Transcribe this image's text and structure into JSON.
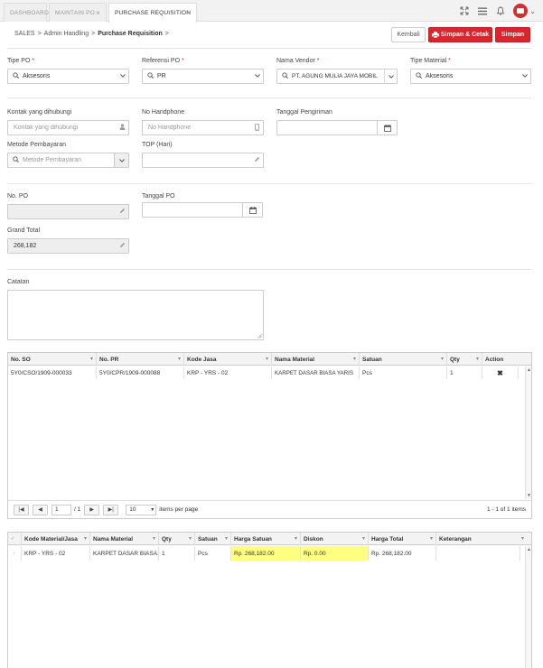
{
  "tabs": [
    {
      "label": "DASHBOARD",
      "closable": false
    },
    {
      "label": "MAINTAIN PO",
      "closable": true
    },
    {
      "label": "PURCHASE REQUISITION",
      "closable": true
    }
  ],
  "tab_close_glyph": "×",
  "topbar": {
    "icons": [
      "expand-icon",
      "menu-icon",
      "bell-icon",
      "user-avatar",
      "chevron-down-icon"
    ],
    "chevron": "⌄"
  },
  "breadcrumb": [
    {
      "label": "SALES",
      "sep": ">"
    },
    {
      "label": "Admin Handling",
      "sep": ">"
    },
    {
      "label": "Purchase Requisition",
      "sep": ">"
    }
  ],
  "actions": {
    "back": "Kembali",
    "save_print": "Simpan & Cetak",
    "save": "Simpan"
  },
  "form": {
    "tipe_po": {
      "label": "Tipe PO",
      "required": "*",
      "value": "Aksesoris"
    },
    "referensi_po": {
      "label": "Referensi PO",
      "required": "*",
      "value": "PR"
    },
    "nama_vendor": {
      "label": "Nama Vendor",
      "required": "*",
      "value": "PT. AGUNG MULIA JAYA MOBIL"
    },
    "tipe_material": {
      "label": "Tipe Material",
      "required": "*",
      "value": "Aksesoris"
    },
    "kontak": {
      "label": "Kontak yang dihubungi",
      "placeholder": "Kontak yang dihubungi"
    },
    "no_handphone": {
      "label": "No Handphone",
      "placeholder": "No Handphone"
    },
    "tanggal_pengiriman": {
      "label": "Tanggal Pengiriman",
      "value": ""
    },
    "metode_pembayaran": {
      "label": "Metode Pembayaran",
      "placeholder": "Metode Pembayaran"
    },
    "top": {
      "label": "TOP (Hari)",
      "value": ""
    },
    "no_po": {
      "label": "No. PO",
      "value": ""
    },
    "tanggal_po": {
      "label": "Tanggal PO",
      "value": ""
    },
    "grand_total": {
      "label": "Grand Total",
      "value": "268,182"
    },
    "catatan": {
      "label": "Catatan",
      "value": ""
    }
  },
  "grid1": {
    "columns": [
      "No. SO",
      "No. PR",
      "Kode Jasa",
      "Nama Material",
      "Satuan",
      "Qty",
      "Action"
    ],
    "rows": [
      [
        "5Y0/CSO/1909-000033",
        "5Y0/CPR/1909-000088",
        "KRP - YRS - 02",
        "KARPET DASAR BIASA YARIS",
        "Pcs",
        "1",
        "✖"
      ]
    ],
    "pager": {
      "first": "|◀",
      "prev": "◀",
      "page": "1",
      "of": "/ 1",
      "next": "▶",
      "last": "▶|",
      "page_size": "10",
      "page_size_caret": "▾",
      "items_per_page": "items per page",
      "summary": "1 - 1 of 1 items"
    }
  },
  "grid2": {
    "columns": [
      "",
      "Kode Material/Jasa",
      "Nama Material",
      "Qty",
      "Satuan",
      "Harga Satuan",
      "Diskon",
      "Harga Total",
      "Keterangan"
    ],
    "rows": [
      [
        "",
        "KRP - YRS - 02",
        "KARPET DASAR BIASA...",
        "1",
        "Pcs",
        "Rp. 268,182.00",
        "Rp. 0.00",
        "Rp. 268,182.00",
        ""
      ]
    ]
  },
  "colors": {
    "primary_red": "#d9262c",
    "highlight": "#ffff80"
  }
}
